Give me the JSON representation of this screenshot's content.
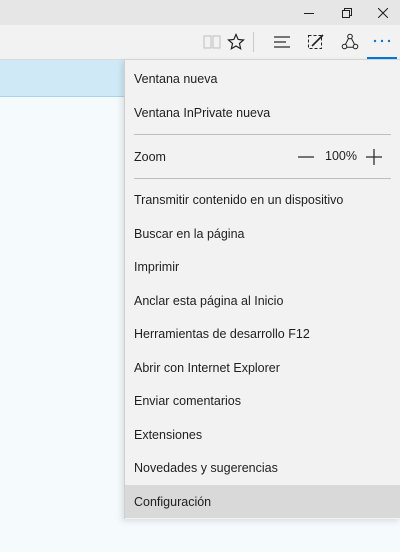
{
  "window": {
    "minimize_icon": "minimize-icon",
    "restore_icon": "restore-icon",
    "close_icon": "close-icon"
  },
  "toolbar": {
    "icons": [
      "reading-view-icon",
      "favorite-star-icon",
      "hub-icon",
      "web-note-icon",
      "share-icon",
      "more-icon"
    ]
  },
  "menu": {
    "top_items": [
      "Ventana nueva",
      "Ventana InPrivate nueva"
    ],
    "zoom": {
      "label": "Zoom",
      "value": "100%"
    },
    "items": [
      "Transmitir contenido en un dispositivo",
      "Buscar en la página",
      "Imprimir",
      "Anclar esta página al Inicio",
      "Herramientas de desarrollo F12",
      "Abrir con Internet Explorer",
      "Enviar comentarios",
      "Extensiones",
      "Novedades y sugerencias",
      "Configuración"
    ]
  },
  "colors": {
    "accent": "#0078d7",
    "menu_bg": "#f2f2f2",
    "selected_bg": "#d9d9d9"
  }
}
